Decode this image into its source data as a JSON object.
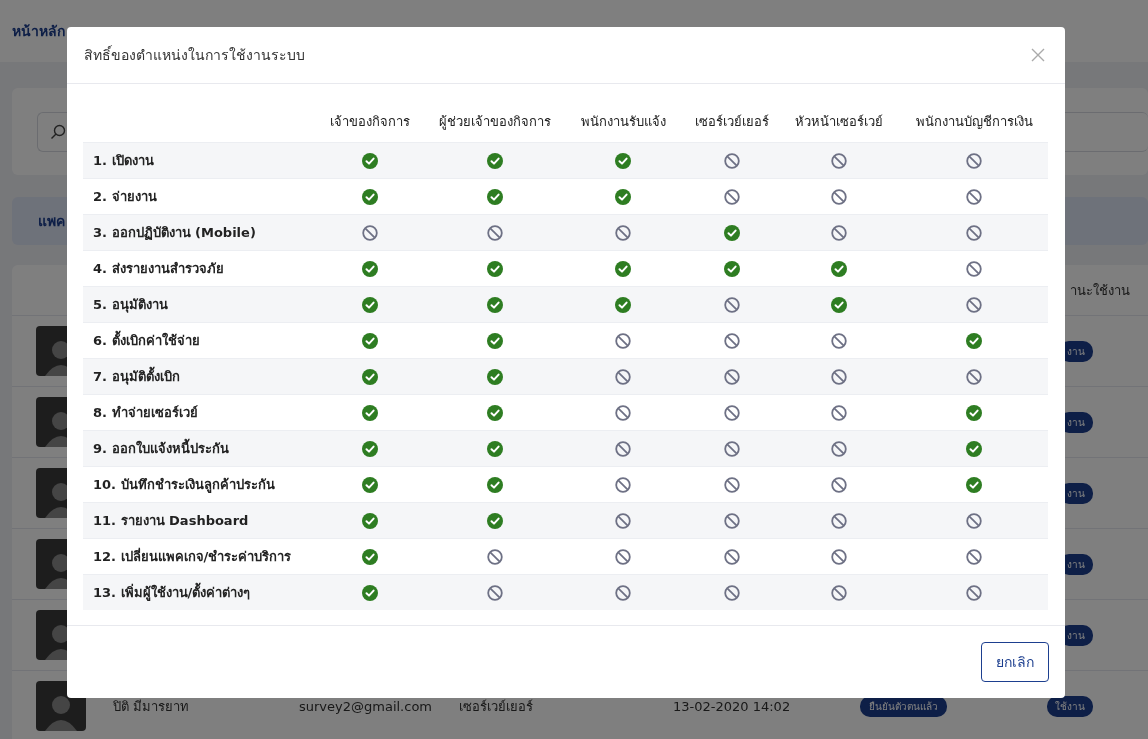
{
  "breadcrumb": "หน้าหลัก",
  "banner": "แพค",
  "background_table": {
    "status_header": "านะใช้งาน",
    "rows": [
      {
        "status": "งาน"
      },
      {
        "status": "งาน"
      },
      {
        "status": "งาน"
      },
      {
        "status": "งาน"
      },
      {
        "status": "งาน"
      },
      {
        "name": "ปิติ มีมารยาท",
        "email": "survey2@gmail.com",
        "role": "เซอร์เวย์เยอร์",
        "date": "13-02-2020 14:02",
        "verification": "ยืนยันตัวตนแล้ว",
        "status": "ใช้งาน"
      }
    ]
  },
  "dialog": {
    "title": "สิทธิ์ของตำแหน่งในการใช้งานระบบ",
    "columns": [
      "เจ้าของกิจการ",
      "ผู้ช่วยเจ้าของกิจการ",
      "พนักงานรับแจ้ง",
      "เซอร์เวย์เยอร์",
      "หัวหน้าเซอร์เวย์",
      "พนักงานบัญชีการเงิน"
    ],
    "permissions": [
      {
        "label": "1. เปิดงาน",
        "allowed": [
          true,
          true,
          true,
          false,
          false,
          false
        ]
      },
      {
        "label": "2. จ่ายงาน",
        "allowed": [
          true,
          true,
          true,
          false,
          false,
          false
        ]
      },
      {
        "label": "3. ออกปฏิบัติงาน (Mobile)",
        "allowed": [
          false,
          false,
          false,
          true,
          false,
          false
        ]
      },
      {
        "label": "4. ส่งรายงานสำรวจภัย",
        "allowed": [
          true,
          true,
          true,
          true,
          true,
          false
        ]
      },
      {
        "label": "5. อนุมัติงาน",
        "allowed": [
          true,
          true,
          true,
          false,
          true,
          false
        ]
      },
      {
        "label": "6. ตั้งเบิกค่าใช้จ่าย",
        "allowed": [
          true,
          true,
          false,
          false,
          false,
          true
        ]
      },
      {
        "label": "7. อนุมัติตั้งเบิก",
        "allowed": [
          true,
          true,
          false,
          false,
          false,
          false
        ]
      },
      {
        "label": "8. ทำจ่ายเซอร์เวย์",
        "allowed": [
          true,
          true,
          false,
          false,
          false,
          true
        ]
      },
      {
        "label": "9. ออกใบแจ้งหนี้ประกัน",
        "allowed": [
          true,
          true,
          false,
          false,
          false,
          true
        ]
      },
      {
        "label": "10. บันทึกชำระเงินลูกค้าประกัน",
        "allowed": [
          true,
          true,
          false,
          false,
          false,
          true
        ]
      },
      {
        "label": "11. รายงาน Dashboard",
        "allowed": [
          true,
          true,
          false,
          false,
          false,
          false
        ]
      },
      {
        "label": "12. เปลี่ยนแพคเกจ/ชำระค่าบริการ",
        "allowed": [
          true,
          false,
          false,
          false,
          false,
          false
        ]
      },
      {
        "label": "13. เพิ่มผู้ใช้งาน/ตั้งค่าต่างๆ",
        "allowed": [
          true,
          false,
          false,
          false,
          false,
          false
        ]
      }
    ],
    "cancel_button": "ยกเลิก"
  }
}
